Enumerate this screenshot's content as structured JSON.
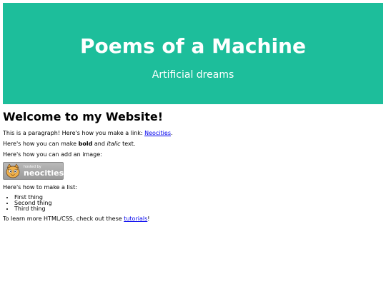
{
  "hero": {
    "title": "Poems of a Machine",
    "subtitle": "Artificial dreams",
    "background_color": "#1dbe9b"
  },
  "content": {
    "heading": "Welcome to my Website!",
    "para1": {
      "text_before": "This is a paragraph! Here's how you make a link: ",
      "link_text": "Neocities",
      "text_after": "."
    },
    "para2": {
      "text_before": "Here's how you can make ",
      "bold": "bold",
      "middle": " and ",
      "italic": "italic",
      "text_after": " text."
    },
    "para3": "Here's how you can add an image:",
    "badge": {
      "small_text": "hosted by",
      "brand": "neocities"
    },
    "list_intro": "Here's how to make a list:",
    "list_items": [
      "First thing",
      "Second thing",
      "Third thing"
    ],
    "para_last": {
      "text_before": "To learn more HTML/CSS, check out these ",
      "link_text": "tutorials",
      "text_after": "!"
    },
    "link_color": "#0000ee"
  }
}
